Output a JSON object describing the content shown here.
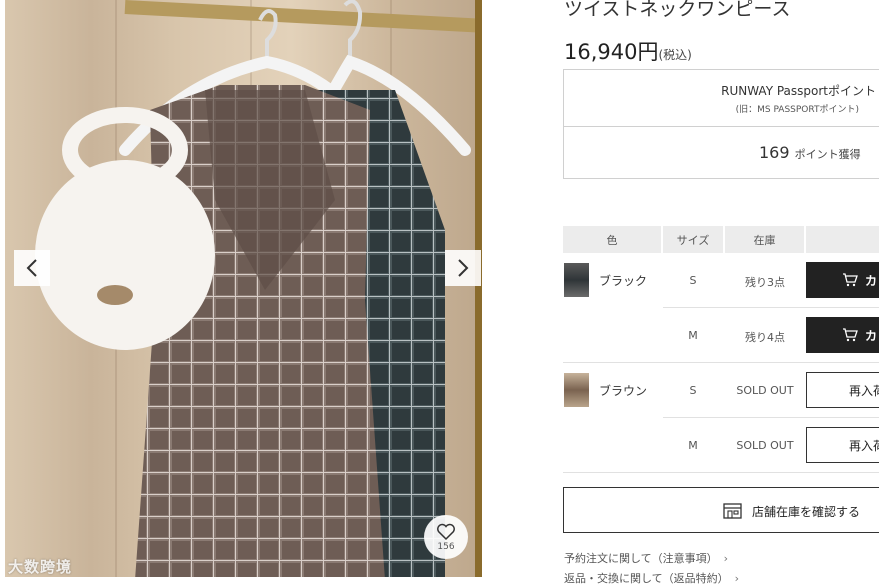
{
  "gallery": {
    "prev_icon": "chevron-left-icon",
    "next_icon": "chevron-right-icon",
    "favorite_icon": "heart-icon",
    "favorite_count": "156",
    "watermark": "大数跨境"
  },
  "product": {
    "title": "ツイストネックワンピース",
    "price": "16,940円",
    "tax_note": "(税込)"
  },
  "points": {
    "label": "RUNWAY Passportポイント",
    "sub_label": "(旧：MS PASSPORTポイント)",
    "value": "169",
    "unit": "ポイント獲得"
  },
  "stock_table": {
    "headers": [
      "色",
      "サイズ",
      "在庫"
    ],
    "colors": [
      {
        "name": "ブラック",
        "swatch": "#3b3b3c",
        "rows": [
          {
            "size": "S",
            "stock": "残り3点",
            "action": "カ",
            "action_type": "cart"
          },
          {
            "size": "M",
            "stock": "残り4点",
            "action": "カ",
            "action_type": "cart"
          }
        ]
      },
      {
        "name": "ブラウン",
        "swatch": "#7a6350",
        "rows": [
          {
            "size": "S",
            "stock": "SOLD OUT",
            "action": "再入荷",
            "action_type": "restock"
          },
          {
            "size": "M",
            "stock": "SOLD OUT",
            "action": "再入荷",
            "action_type": "restock"
          }
        ]
      }
    ]
  },
  "store_button": {
    "label": "店舗在庫を確認する",
    "icon": "store-icon"
  },
  "links": [
    {
      "label": "予約注文に関して（注意事項）",
      "chevron": "›"
    },
    {
      "label": "返品・交換に関して（返品特約）",
      "chevron": "›"
    }
  ],
  "colors": {
    "dark_button": "#222222",
    "header_bg": "#ececec",
    "border": "#d0d0d0"
  }
}
